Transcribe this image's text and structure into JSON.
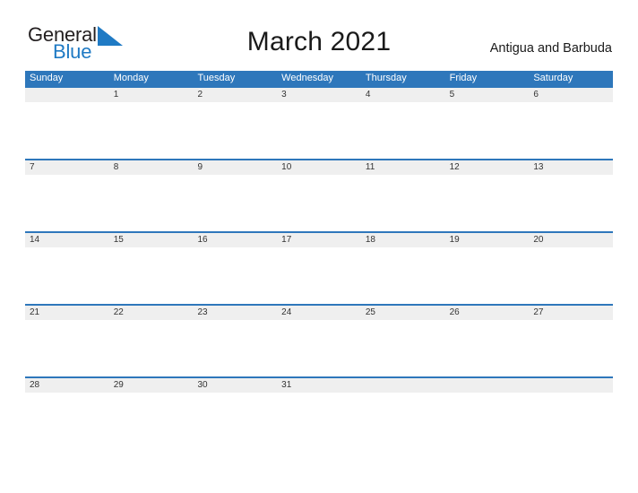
{
  "logo": {
    "text_primary": "General",
    "text_secondary": "Blue",
    "triangle_icon": "blue-triangle-icon",
    "primary_color": "#231f20",
    "secondary_color": "#1f7ac4"
  },
  "header": {
    "title": "March 2021",
    "country": "Antigua and Barbuda"
  },
  "colors": {
    "header_bar": "#2e77bb",
    "day_band": "#efefef",
    "row_border": "#2e77bb",
    "page_background": "#ffffff"
  },
  "calendar": {
    "month": "March",
    "year": "2021",
    "weekday_headers": [
      "Sunday",
      "Monday",
      "Tuesday",
      "Wednesday",
      "Thursday",
      "Friday",
      "Saturday"
    ],
    "weeks": [
      [
        "",
        "1",
        "2",
        "3",
        "4",
        "5",
        "6"
      ],
      [
        "7",
        "8",
        "9",
        "10",
        "11",
        "12",
        "13"
      ],
      [
        "14",
        "15",
        "16",
        "17",
        "18",
        "19",
        "20"
      ],
      [
        "21",
        "22",
        "23",
        "24",
        "25",
        "26",
        "27"
      ],
      [
        "28",
        "29",
        "30",
        "31",
        "",
        "",
        ""
      ]
    ]
  }
}
